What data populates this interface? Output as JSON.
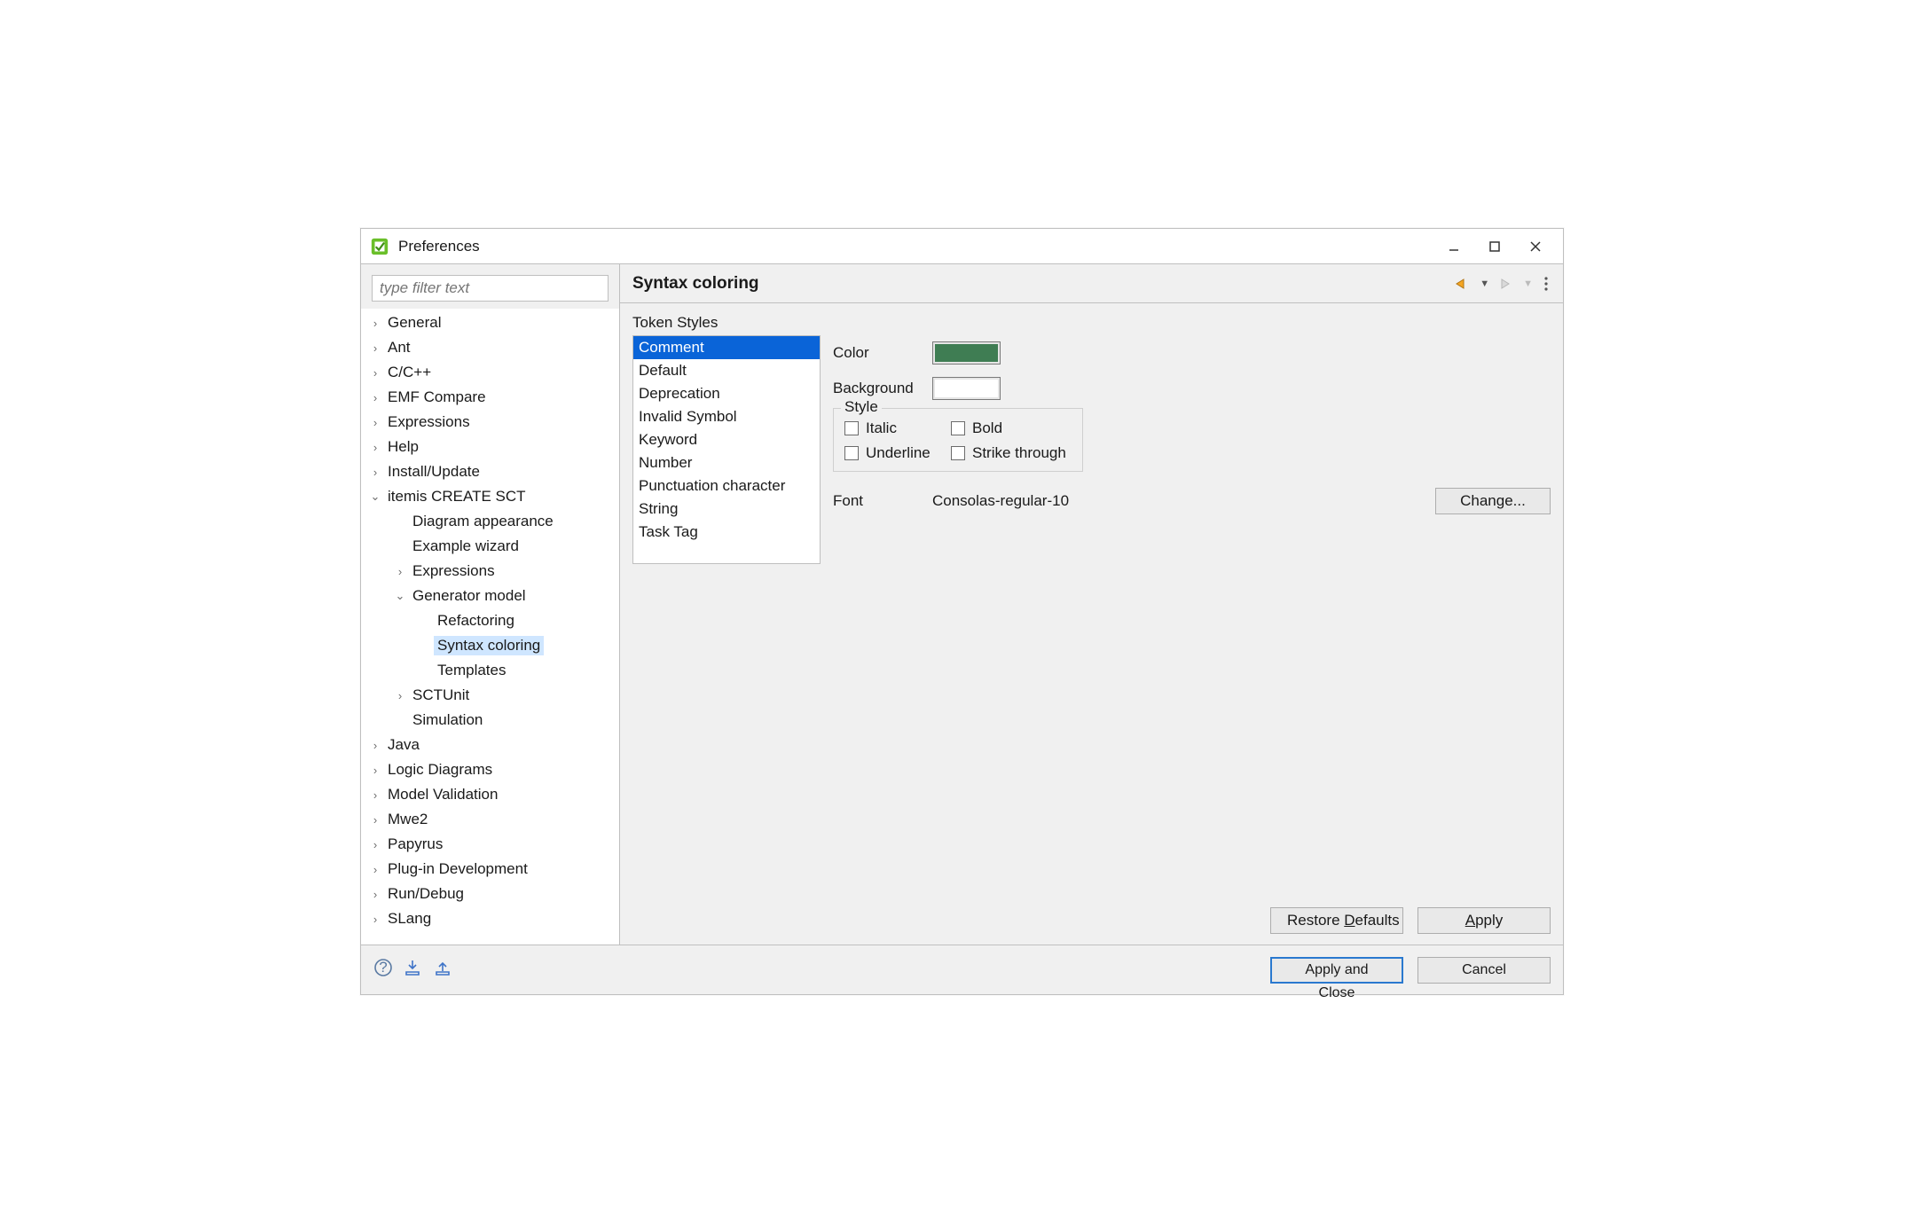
{
  "window": {
    "title": "Preferences"
  },
  "sidebar": {
    "filter_placeholder": "type filter text",
    "items": [
      {
        "label": "General",
        "expanded": false,
        "depth": 0,
        "has_children": true
      },
      {
        "label": "Ant",
        "expanded": false,
        "depth": 0,
        "has_children": true
      },
      {
        "label": "C/C++",
        "expanded": false,
        "depth": 0,
        "has_children": true
      },
      {
        "label": "EMF Compare",
        "expanded": false,
        "depth": 0,
        "has_children": true
      },
      {
        "label": "Expressions",
        "expanded": false,
        "depth": 0,
        "has_children": true
      },
      {
        "label": "Help",
        "expanded": false,
        "depth": 0,
        "has_children": true
      },
      {
        "label": "Install/Update",
        "expanded": false,
        "depth": 0,
        "has_children": true
      },
      {
        "label": "itemis CREATE SCT",
        "expanded": true,
        "depth": 0,
        "has_children": true
      },
      {
        "label": "Diagram appearance",
        "expanded": false,
        "depth": 1,
        "has_children": false
      },
      {
        "label": "Example wizard",
        "expanded": false,
        "depth": 1,
        "has_children": false
      },
      {
        "label": "Expressions",
        "expanded": false,
        "depth": 1,
        "has_children": true
      },
      {
        "label": "Generator model",
        "expanded": true,
        "depth": 1,
        "has_children": true
      },
      {
        "label": "Refactoring",
        "expanded": false,
        "depth": 2,
        "has_children": false
      },
      {
        "label": "Syntax coloring",
        "expanded": false,
        "depth": 2,
        "has_children": false,
        "selected": true
      },
      {
        "label": "Templates",
        "expanded": false,
        "depth": 2,
        "has_children": false
      },
      {
        "label": "SCTUnit",
        "expanded": false,
        "depth": 1,
        "has_children": true
      },
      {
        "label": "Simulation",
        "expanded": false,
        "depth": 1,
        "has_children": false
      },
      {
        "label": "Java",
        "expanded": false,
        "depth": 0,
        "has_children": true
      },
      {
        "label": "Logic Diagrams",
        "expanded": false,
        "depth": 0,
        "has_children": true
      },
      {
        "label": "Model Validation",
        "expanded": false,
        "depth": 0,
        "has_children": true
      },
      {
        "label": "Mwe2",
        "expanded": false,
        "depth": 0,
        "has_children": true
      },
      {
        "label": "Papyrus",
        "expanded": false,
        "depth": 0,
        "has_children": true
      },
      {
        "label": "Plug-in Development",
        "expanded": false,
        "depth": 0,
        "has_children": true
      },
      {
        "label": "Run/Debug",
        "expanded": false,
        "depth": 0,
        "has_children": true
      },
      {
        "label": "SLang",
        "expanded": false,
        "depth": 0,
        "has_children": true
      }
    ]
  },
  "page": {
    "title": "Syntax coloring",
    "token_styles_label": "Token Styles",
    "tokens": [
      "Comment",
      "Default",
      "Deprecation",
      "Invalid Symbol",
      "Keyword",
      "Number",
      "Punctuation character",
      "String",
      "Task Tag"
    ],
    "selected_token_index": 0,
    "color_label": "Color",
    "color_value": "#3f7d53",
    "background_label": "Background",
    "background_value": "#ffffff",
    "style_label": "Style",
    "style_options": {
      "italic": "Italic",
      "bold": "Bold",
      "underline": "Underline",
      "strike": "Strike through"
    },
    "font_label": "Font",
    "font_value": "Consolas-regular-10",
    "change_btn": "Change...",
    "restore_defaults": "Restore Defaults",
    "apply": "Apply"
  },
  "footer": {
    "apply_close": "Apply and Close",
    "cancel": "Cancel"
  }
}
